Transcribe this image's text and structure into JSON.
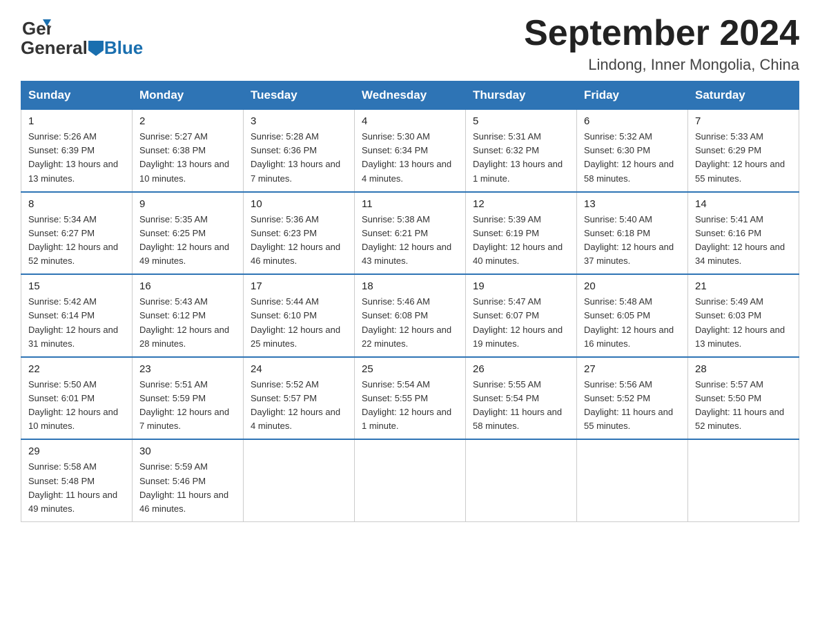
{
  "header": {
    "logo_general": "General",
    "logo_blue": "Blue",
    "title": "September 2024",
    "subtitle": "Lindong, Inner Mongolia, China"
  },
  "weekdays": [
    "Sunday",
    "Monday",
    "Tuesday",
    "Wednesday",
    "Thursday",
    "Friday",
    "Saturday"
  ],
  "weeks": [
    [
      {
        "day": "1",
        "sunrise": "5:26 AM",
        "sunset": "6:39 PM",
        "daylight": "13 hours and 13 minutes."
      },
      {
        "day": "2",
        "sunrise": "5:27 AM",
        "sunset": "6:38 PM",
        "daylight": "13 hours and 10 minutes."
      },
      {
        "day": "3",
        "sunrise": "5:28 AM",
        "sunset": "6:36 PM",
        "daylight": "13 hours and 7 minutes."
      },
      {
        "day": "4",
        "sunrise": "5:30 AM",
        "sunset": "6:34 PM",
        "daylight": "13 hours and 4 minutes."
      },
      {
        "day": "5",
        "sunrise": "5:31 AM",
        "sunset": "6:32 PM",
        "daylight": "13 hours and 1 minute."
      },
      {
        "day": "6",
        "sunrise": "5:32 AM",
        "sunset": "6:30 PM",
        "daylight": "12 hours and 58 minutes."
      },
      {
        "day": "7",
        "sunrise": "5:33 AM",
        "sunset": "6:29 PM",
        "daylight": "12 hours and 55 minutes."
      }
    ],
    [
      {
        "day": "8",
        "sunrise": "5:34 AM",
        "sunset": "6:27 PM",
        "daylight": "12 hours and 52 minutes."
      },
      {
        "day": "9",
        "sunrise": "5:35 AM",
        "sunset": "6:25 PM",
        "daylight": "12 hours and 49 minutes."
      },
      {
        "day": "10",
        "sunrise": "5:36 AM",
        "sunset": "6:23 PM",
        "daylight": "12 hours and 46 minutes."
      },
      {
        "day": "11",
        "sunrise": "5:38 AM",
        "sunset": "6:21 PM",
        "daylight": "12 hours and 43 minutes."
      },
      {
        "day": "12",
        "sunrise": "5:39 AM",
        "sunset": "6:19 PM",
        "daylight": "12 hours and 40 minutes."
      },
      {
        "day": "13",
        "sunrise": "5:40 AM",
        "sunset": "6:18 PM",
        "daylight": "12 hours and 37 minutes."
      },
      {
        "day": "14",
        "sunrise": "5:41 AM",
        "sunset": "6:16 PM",
        "daylight": "12 hours and 34 minutes."
      }
    ],
    [
      {
        "day": "15",
        "sunrise": "5:42 AM",
        "sunset": "6:14 PM",
        "daylight": "12 hours and 31 minutes."
      },
      {
        "day": "16",
        "sunrise": "5:43 AM",
        "sunset": "6:12 PM",
        "daylight": "12 hours and 28 minutes."
      },
      {
        "day": "17",
        "sunrise": "5:44 AM",
        "sunset": "6:10 PM",
        "daylight": "12 hours and 25 minutes."
      },
      {
        "day": "18",
        "sunrise": "5:46 AM",
        "sunset": "6:08 PM",
        "daylight": "12 hours and 22 minutes."
      },
      {
        "day": "19",
        "sunrise": "5:47 AM",
        "sunset": "6:07 PM",
        "daylight": "12 hours and 19 minutes."
      },
      {
        "day": "20",
        "sunrise": "5:48 AM",
        "sunset": "6:05 PM",
        "daylight": "12 hours and 16 minutes."
      },
      {
        "day": "21",
        "sunrise": "5:49 AM",
        "sunset": "6:03 PM",
        "daylight": "12 hours and 13 minutes."
      }
    ],
    [
      {
        "day": "22",
        "sunrise": "5:50 AM",
        "sunset": "6:01 PM",
        "daylight": "12 hours and 10 minutes."
      },
      {
        "day": "23",
        "sunrise": "5:51 AM",
        "sunset": "5:59 PM",
        "daylight": "12 hours and 7 minutes."
      },
      {
        "day": "24",
        "sunrise": "5:52 AM",
        "sunset": "5:57 PM",
        "daylight": "12 hours and 4 minutes."
      },
      {
        "day": "25",
        "sunrise": "5:54 AM",
        "sunset": "5:55 PM",
        "daylight": "12 hours and 1 minute."
      },
      {
        "day": "26",
        "sunrise": "5:55 AM",
        "sunset": "5:54 PM",
        "daylight": "11 hours and 58 minutes."
      },
      {
        "day": "27",
        "sunrise": "5:56 AM",
        "sunset": "5:52 PM",
        "daylight": "11 hours and 55 minutes."
      },
      {
        "day": "28",
        "sunrise": "5:57 AM",
        "sunset": "5:50 PM",
        "daylight": "11 hours and 52 minutes."
      }
    ],
    [
      {
        "day": "29",
        "sunrise": "5:58 AM",
        "sunset": "5:48 PM",
        "daylight": "11 hours and 49 minutes."
      },
      {
        "day": "30",
        "sunrise": "5:59 AM",
        "sunset": "5:46 PM",
        "daylight": "11 hours and 46 minutes."
      },
      null,
      null,
      null,
      null,
      null
    ]
  ]
}
